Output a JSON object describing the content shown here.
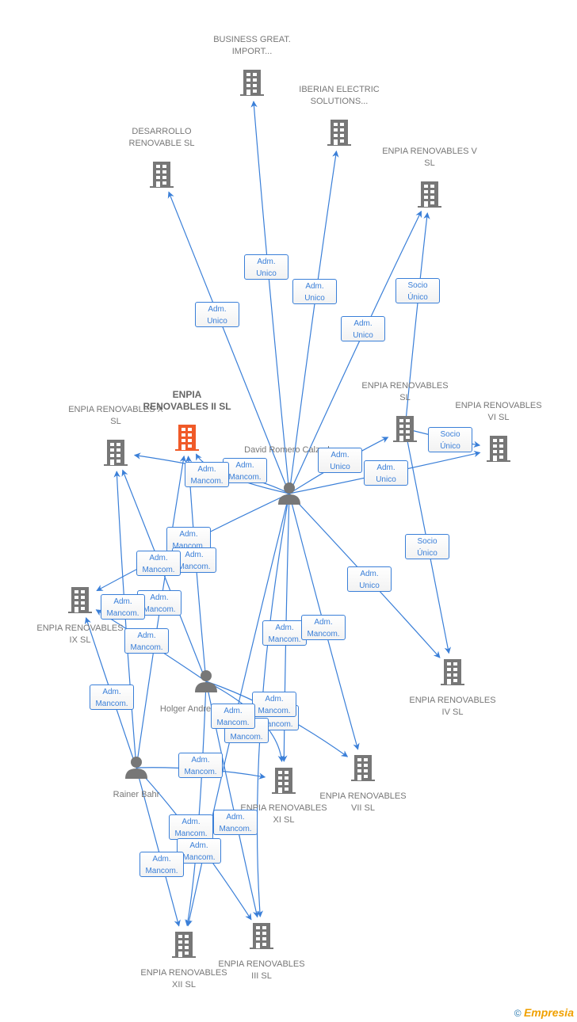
{
  "colors": {
    "edge": "#3a7fd8",
    "node": "#777777",
    "focus": "#f05a28"
  },
  "nodes": [
    {
      "id": "business",
      "type": "company",
      "label": "BUSINESS GREAT. IMPORT..."
    },
    {
      "id": "iberian",
      "type": "company",
      "label": "IBERIAN ELECTRIC SOLUTIONS..."
    },
    {
      "id": "desarrollo",
      "type": "company",
      "label": "DESARROLLO RENOVABLE SL"
    },
    {
      "id": "v",
      "type": "company",
      "label": "ENPIA RENOVABLES V SL"
    },
    {
      "id": "sl",
      "type": "company",
      "label": "ENPIA RENOVABLES SL"
    },
    {
      "id": "vi",
      "type": "company",
      "label": "ENPIA RENOVABLES VI SL"
    },
    {
      "id": "x",
      "type": "company",
      "label": "ENPIA RENOVABLES X SL"
    },
    {
      "id": "ii",
      "type": "company",
      "label": "ENPIA RENOVABLES II SL",
      "focus": true
    },
    {
      "id": "david",
      "type": "person",
      "label": "David Romero Calzado"
    },
    {
      "id": "ix",
      "type": "company",
      "label": "ENPIA RENOVABLES IX SL"
    },
    {
      "id": "holger",
      "type": "person",
      "label": "Holger Andreas Rausch"
    },
    {
      "id": "iv",
      "type": "company",
      "label": "ENPIA RENOVABLES IV SL"
    },
    {
      "id": "rainer",
      "type": "person",
      "label": "Rainer Bahr"
    },
    {
      "id": "xi",
      "type": "company",
      "label": "ENPIA RENOVABLES XI SL"
    },
    {
      "id": "vii",
      "type": "company",
      "label": "ENPIA RENOVABLES VII SL"
    },
    {
      "id": "xii",
      "type": "company",
      "label": "ENPIA RENOVABLES XII SL"
    },
    {
      "id": "iii",
      "type": "company",
      "label": "ENPIA RENOVABLES III SL"
    }
  ],
  "edges": [
    {
      "from": "david",
      "to": "desarrollo",
      "l1": "Adm.",
      "l2": "Unico"
    },
    {
      "from": "david",
      "to": "business",
      "l1": "Adm.",
      "l2": "Unico"
    },
    {
      "from": "david",
      "to": "iberian",
      "l1": "Adm.",
      "l2": "Unico"
    },
    {
      "from": "david",
      "to": "v",
      "l1": "Adm.",
      "l2": "Unico"
    },
    {
      "from": "sl",
      "to": "v",
      "l1": "Socio",
      "l2": "Único"
    },
    {
      "from": "david",
      "to": "sl",
      "l1": "Adm.",
      "l2": "Unico"
    },
    {
      "from": "david",
      "to": "vi",
      "l1": "Adm.",
      "l2": "Unico"
    },
    {
      "from": "sl",
      "to": "vi",
      "l1": "Socio",
      "l2": "Único"
    },
    {
      "from": "sl",
      "to": "iv",
      "l1": "Socio",
      "l2": "Único"
    },
    {
      "from": "david",
      "to": "iv",
      "l1": "Adm.",
      "l2": "Unico"
    },
    {
      "from": "david",
      "to": "x",
      "l1": "Adm.",
      "l2": "Mancom."
    },
    {
      "from": "david",
      "to": "ii",
      "l1": "Adm.",
      "l2": "Mancom."
    },
    {
      "from": "david",
      "to": "ix",
      "l1": "Adm.",
      "l2": "Mancom."
    },
    {
      "from": "holger",
      "to": "ii",
      "l1": "Adm.",
      "l2": "Mancom."
    },
    {
      "from": "holger",
      "to": "x",
      "l1": "Adm.",
      "l2": "Mancom."
    },
    {
      "from": "rainer",
      "to": "ii",
      "l1": "Adm.",
      "l2": "Mancom."
    },
    {
      "from": "rainer",
      "to": "x",
      "l1": "Adm.",
      "l2": "Mancom."
    },
    {
      "from": "holger",
      "to": "ix",
      "l1": "Adm.",
      "l2": "Mancom."
    },
    {
      "from": "rainer",
      "to": "ix",
      "l1": "Adm.",
      "l2": "Mancom."
    },
    {
      "from": "david",
      "to": "xi",
      "l1": "Adm.",
      "l2": "Mancom."
    },
    {
      "from": "david",
      "to": "vii",
      "l1": "Adm.",
      "l2": "Mancom."
    },
    {
      "from": "holger",
      "to": "xi",
      "l1": "Adm.",
      "l2": "Mancom."
    },
    {
      "from": "holger",
      "to": "vii",
      "l1": "Adm.",
      "l2": "Mancom."
    },
    {
      "from": "rainer",
      "to": "xi",
      "l1": "Adm.",
      "l2": "Mancom."
    },
    {
      "from": "holger",
      "to": "iii",
      "l1": "Adm.",
      "l2": "Mancom."
    },
    {
      "from": "rainer",
      "to": "iii",
      "l1": "Adm.",
      "l2": "Mancom."
    },
    {
      "from": "holger",
      "to": "xii",
      "l1": "Adm.",
      "l2": "Mancom."
    },
    {
      "from": "rainer",
      "to": "xii",
      "l1": "Adm.",
      "l2": "Mancom."
    },
    {
      "from": "david",
      "to": "iii",
      "l1": "Adm.",
      "l2": "Mancom."
    },
    {
      "from": "david",
      "to": "xii",
      "l1": "Adm.",
      "l2": "Mancom."
    }
  ],
  "footer": {
    "copyright": "©",
    "brand": "Empresia"
  }
}
